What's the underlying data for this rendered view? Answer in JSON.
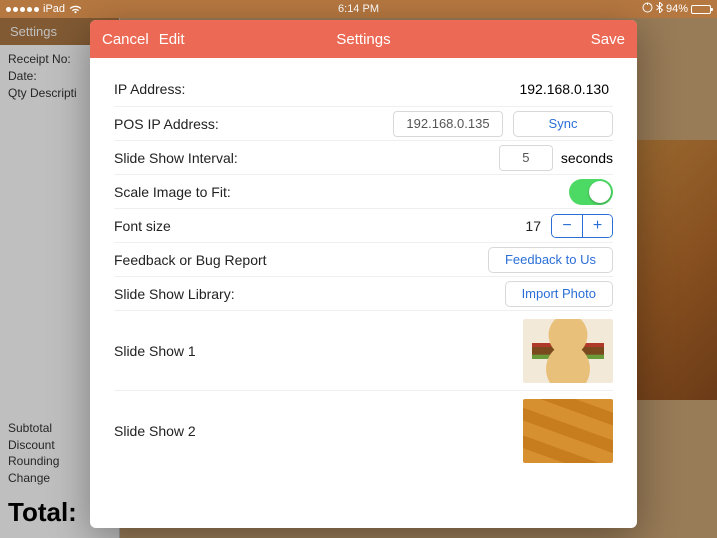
{
  "statusbar": {
    "carrier": "iPad",
    "time": "6:14 PM",
    "battery_pct": "94%"
  },
  "receipt": {
    "header": "Settings",
    "receipt_no_label": "Receipt No:",
    "date_label": "Date:",
    "qty_desc_label": "Qty  Descripti",
    "subtotal_label": "Subtotal",
    "discount_label": "Discount",
    "rounding_label": "Rounding",
    "change_label": "Change",
    "total_label": "Total:"
  },
  "modal": {
    "cancel": "Cancel",
    "edit": "Edit",
    "title": "Settings",
    "save": "Save"
  },
  "settings": {
    "ip_label": "IP Address:",
    "ip_value": "192.168.0.130",
    "pos_ip_label": "POS IP Address:",
    "pos_ip_value": "192.168.0.135",
    "sync_btn": "Sync",
    "interval_label": "Slide Show Interval:",
    "interval_value": "5",
    "interval_suffix": "seconds",
    "scale_label": "Scale Image to Fit:",
    "scale_on": true,
    "font_label": "Font size",
    "font_value": "17",
    "feedback_label": "Feedback or Bug Report",
    "feedback_btn": "Feedback to Us",
    "library_label": "Slide Show Library:",
    "import_btn": "Import Photo",
    "slide1": "Slide Show 1",
    "slide2": "Slide Show 2"
  }
}
